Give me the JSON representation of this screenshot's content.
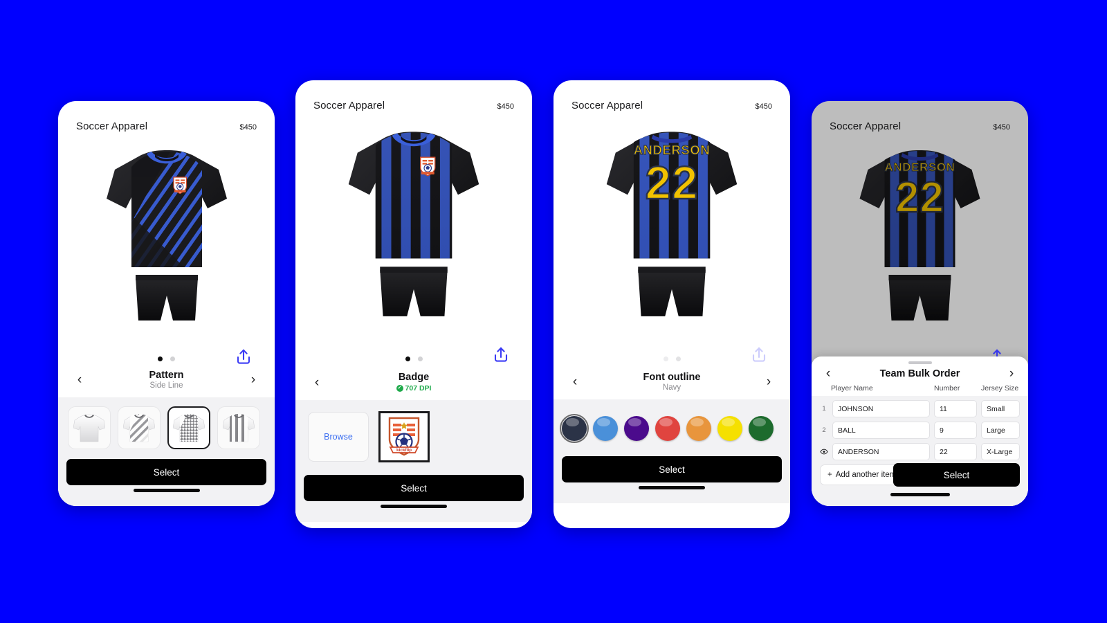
{
  "app": {
    "background_color": "#0000FF",
    "product_title": "Soccer Apparel",
    "product_price": "$450",
    "select_label": "Select"
  },
  "cards": [
    {
      "id": "pattern",
      "title": "Soccer Apparel",
      "price": "$450",
      "option_title": "Pattern",
      "option_value": "Side Line",
      "prev_label": "‹",
      "next_label": "›",
      "select_label": "Select",
      "dots": [
        {
          "active": true
        },
        {
          "active": false
        }
      ],
      "thumbnails": [
        {
          "name": "plain"
        },
        {
          "name": "diagonal-fade"
        },
        {
          "name": "side-line",
          "selected": true
        },
        {
          "name": "vertical-stripe"
        }
      ]
    },
    {
      "id": "badge",
      "title": "Soccer Apparel",
      "price": "$450",
      "option_title": "Badge",
      "dpi_text": "707 DPI",
      "browse_label": "Browse",
      "badge_caption": "kickflip",
      "prev_label": "‹",
      "select_label": "Select",
      "dots": [
        {
          "active": true
        },
        {
          "active": false
        }
      ]
    },
    {
      "id": "font-outline",
      "title": "Soccer Apparel",
      "price": "$450",
      "option_title": "Font outline",
      "option_value": "Navy",
      "prev_label": "‹",
      "next_label": "›",
      "select_label": "Select",
      "dots": [
        {
          "active": false
        },
        {
          "active": true
        }
      ],
      "swatches": [
        {
          "name": "navy",
          "color": "#2b3347",
          "selected": true
        },
        {
          "name": "blue",
          "color": "#4a90d9",
          "selected": false
        },
        {
          "name": "purple",
          "color": "#4b0b8c",
          "selected": false
        },
        {
          "name": "red",
          "color": "#e0443f",
          "selected": false
        },
        {
          "name": "orange",
          "color": "#e8953c",
          "selected": false
        },
        {
          "name": "yellow",
          "color": "#f5e000",
          "selected": false
        },
        {
          "name": "green",
          "color": "#1d6b2d",
          "selected": false
        }
      ]
    },
    {
      "id": "bulk-order",
      "title": "Soccer Apparel",
      "price": "$450",
      "sheet_title": "Team Bulk Order",
      "prev_label": "‹",
      "next_label": "›",
      "columns": [
        "Player Name",
        "Number",
        "Jersey Size"
      ],
      "rows": [
        {
          "index": "1",
          "player_name": "JOHNSON",
          "number": "11",
          "size": "Small"
        },
        {
          "index": "2",
          "player_name": "BALL",
          "number": "9",
          "size": "Large"
        },
        {
          "index": "eye",
          "player_name": "ANDERSON",
          "number": "22",
          "size": "X-Large"
        }
      ],
      "add_label": "Add another item",
      "add_icon": "+",
      "select_label": "Select",
      "dots": [
        {
          "active": false
        },
        {
          "active": true
        }
      ]
    }
  ],
  "jersey": {
    "player_name": "ANDERSON",
    "player_number": "22",
    "primary_color": "#3a5fd9",
    "secondary_color": "#121214",
    "number_color": "#f2c200"
  }
}
